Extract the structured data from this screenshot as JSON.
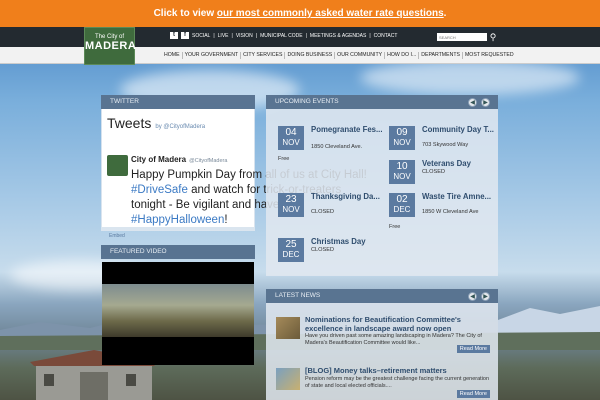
{
  "alert": {
    "prefix": "Click to view ",
    "link": "our most commonly asked water rate questions",
    "suffix": "."
  },
  "logo": {
    "line1": "The City of",
    "line2": "MADERA"
  },
  "utility_links": [
    "SOCIAL",
    "LIVE",
    "VISION",
    "MUNICIPAL CODE",
    "MEETINGS & AGENDAS",
    "CONTACT"
  ],
  "search": {
    "placeholder": "SEARCH"
  },
  "nav": [
    "HOME",
    "YOUR GOVERNMENT",
    "CITY SERVICES",
    "DOING BUSINESS",
    "OUR COMMUNITY",
    "HOW DO I...",
    "DEPARTMENTS",
    "MOST REQUESTED"
  ],
  "twitter": {
    "header": "TWITTER",
    "title": "Tweets",
    "by": "by @CityofMadera",
    "name": "City of Madera",
    "handle": "@CityofMadera",
    "line1": "Happy Pumpkin Day from all of us at City Hall!",
    "hash1": "#DriveSafe",
    "line2_rest": " and watch for trick-or-treaters",
    "line3": "tonight - Be vigilant and have fun!",
    "hash2": "#HappyHalloween",
    "line4_rest": "!",
    "embed": "Embed"
  },
  "featured_video": {
    "header": "FEATURED VIDEO"
  },
  "events": {
    "header": "UPCOMING EVENTS",
    "items": [
      {
        "day": "04",
        "month": "NOV",
        "title": "Pomegranate Fes...",
        "location": "1850 Cleveland Ave.",
        "free": "Free"
      },
      {
        "day": "09",
        "month": "NOV",
        "title": "Community Day T...",
        "location": "703 Skywood Way",
        "free": ""
      },
      {
        "day": "10",
        "month": "NOV",
        "title": "Veterans Day",
        "location": "CLOSED",
        "free": ""
      },
      {
        "day": "23",
        "month": "NOV",
        "title": "Thanksgiving Da...",
        "location": "CLOSED",
        "free": ""
      },
      {
        "day": "02",
        "month": "DEC",
        "title": "Waste Tire Amne...",
        "location": "1850 W Cleveland Ave",
        "free": "Free"
      },
      {
        "day": "25",
        "month": "DEC",
        "title": "Christmas Day",
        "location": "CLOSED",
        "free": ""
      }
    ]
  },
  "news": {
    "header": "LATEST NEWS",
    "items": [
      {
        "title": "Nominations for Beautification Committee's excellence in landscape award now open",
        "text": "Have you driven past some amazing landscaping in Madera? The City of Madera's Beautification Committee would like...",
        "more": "Read More"
      },
      {
        "title": "[BLOG] Money talks–retirement matters",
        "text": "Pension reform may be the greatest challenge facing the current generation of state and local elected officials....",
        "more": "Read More"
      }
    ]
  },
  "icons": {
    "twitter": "twitter-icon",
    "facebook": "facebook-icon",
    "search": "search-icon",
    "prev": "chevron-left-icon",
    "next": "chevron-right-icon"
  },
  "colors": {
    "alert": "#f07f1b",
    "header": "#232a30",
    "logo": "#3f6b3d",
    "panel_head": "#526e8c",
    "date_box": "#5b7aa0"
  }
}
